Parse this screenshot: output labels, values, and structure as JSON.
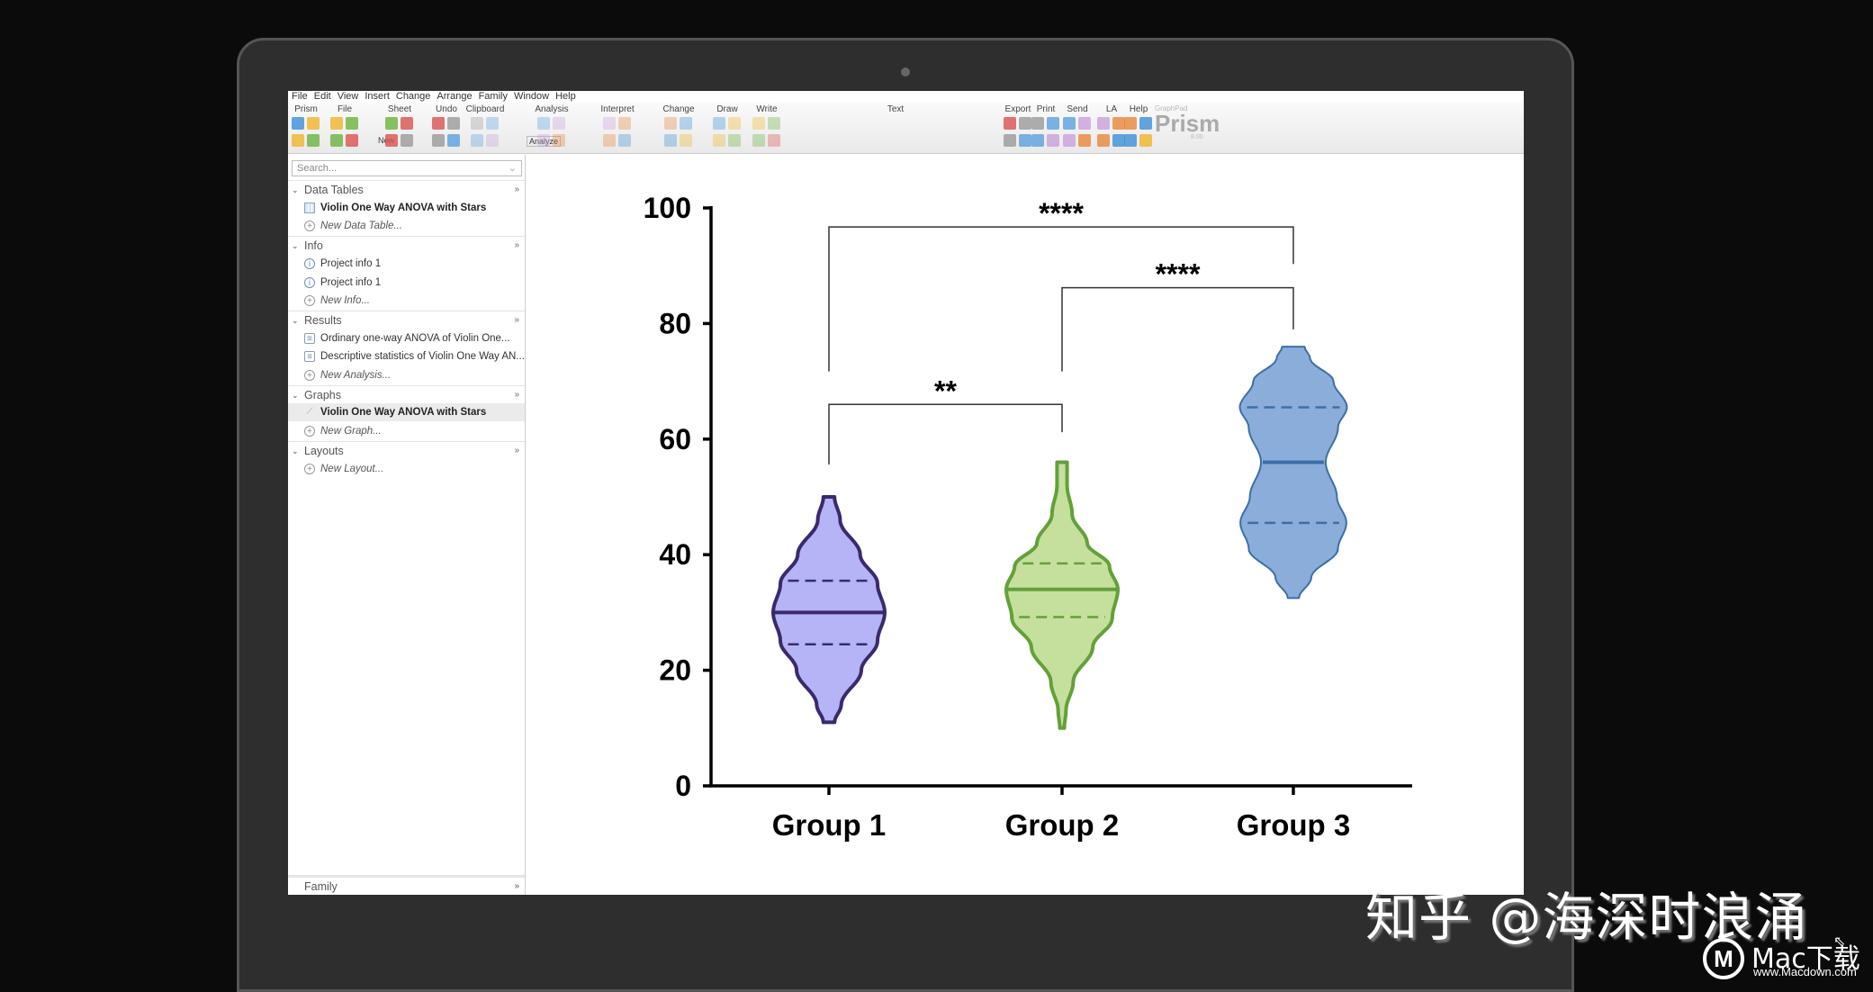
{
  "menu": [
    "File",
    "Edit",
    "View",
    "Insert",
    "Change",
    "Arrange",
    "Family",
    "Window",
    "Help"
  ],
  "ribbon": {
    "groups": [
      {
        "label": "Prism",
        "pos": 20
      },
      {
        "label": "File",
        "pos": 63
      },
      {
        "label": "Sheet",
        "pos": 124
      },
      {
        "label": "Undo",
        "pos": 176
      },
      {
        "label": "Clipboard",
        "pos": 219
      },
      {
        "label": "Analysis",
        "pos": 293
      },
      {
        "label": "Interpret",
        "pos": 366
      },
      {
        "label": "Change",
        "pos": 434
      },
      {
        "label": "Draw",
        "pos": 488
      },
      {
        "label": "Write",
        "pos": 532
      },
      {
        "label": "Text",
        "pos": 675
      },
      {
        "label": "Export",
        "pos": 811
      },
      {
        "label": "Print",
        "pos": 842
      },
      {
        "label": "Send",
        "pos": 877
      },
      {
        "label": "LA",
        "pos": 915
      },
      {
        "label": "Help",
        "pos": 945
      }
    ],
    "new_label": "New",
    "analyze_label": "Analyze",
    "brand_small": "GraphPad",
    "brand": "Prism",
    "version": "8.00"
  },
  "sidebar": {
    "search_placeholder": "Search...",
    "sections": [
      {
        "title": "Data Tables",
        "items": [
          {
            "label": "Violin One Way ANOVA with Stars",
            "icon": "data-table-icon",
            "style": "bold"
          },
          {
            "label": "New Data Table...",
            "icon": "plus-circle-icon",
            "style": "new"
          }
        ]
      },
      {
        "title": "Info",
        "items": [
          {
            "label": "Project info 1",
            "icon": "info-icon",
            "style": "normal"
          },
          {
            "label": "Project info 1",
            "icon": "info-icon",
            "style": "normal"
          },
          {
            "label": "New Info...",
            "icon": "plus-circle-icon",
            "style": "new"
          }
        ]
      },
      {
        "title": "Results",
        "items": [
          {
            "label": "Ordinary one-way ANOVA of Violin One...",
            "icon": "results-icon",
            "style": "normal"
          },
          {
            "label": "Descriptive statistics of Violin One Way AN...",
            "icon": "results-icon",
            "style": "normal"
          },
          {
            "label": "New Analysis...",
            "icon": "plus-circle-icon",
            "style": "new"
          }
        ]
      },
      {
        "title": "Graphs",
        "items": [
          {
            "label": "Violin One Way ANOVA with Stars",
            "icon": "graph-icon",
            "style": "bold selected"
          },
          {
            "label": "New Graph...",
            "icon": "plus-circle-icon",
            "style": "new"
          }
        ]
      },
      {
        "title": "Layouts",
        "items": [
          {
            "label": "New Layout...",
            "icon": "plus-circle-icon",
            "style": "new"
          }
        ]
      }
    ],
    "family_label": "Family"
  },
  "chart_data": {
    "type": "violin",
    "title": "",
    "xlabel": "",
    "ylabel": "",
    "ylim": [
      0,
      100
    ],
    "yticks": [
      0,
      20,
      40,
      60,
      80,
      100
    ],
    "grid": false,
    "categories": [
      "Group 1",
      "Group 2",
      "Group 3"
    ],
    "series": [
      {
        "min": 11,
        "q1": 24.5,
        "median": 30,
        "q3": 35.5,
        "max": 50,
        "fill": "#b5b4f7",
        "stroke": "#3a2a6c",
        "density": [
          [
            11,
            0.1
          ],
          [
            14,
            0.22
          ],
          [
            20,
            0.58
          ],
          [
            25,
            0.87
          ],
          [
            30,
            1.0
          ],
          [
            35,
            0.87
          ],
          [
            40,
            0.56
          ],
          [
            46,
            0.2
          ],
          [
            50,
            0.1
          ]
        ]
      },
      {
        "min": 10,
        "q1": 29.2,
        "median": 34,
        "q3": 38.5,
        "max": 56,
        "fill": "#c5e09c",
        "stroke": "#64a03a",
        "density": [
          [
            10,
            0.04
          ],
          [
            13,
            0.07
          ],
          [
            18,
            0.2
          ],
          [
            24,
            0.55
          ],
          [
            29,
            0.9
          ],
          [
            34,
            1.0
          ],
          [
            38,
            0.85
          ],
          [
            42,
            0.45
          ],
          [
            47,
            0.18
          ],
          [
            52,
            0.09
          ],
          [
            56,
            0.09
          ]
        ]
      },
      {
        "min": 32.5,
        "q1": 45.5,
        "median": 56,
        "q3": 65.5,
        "max": 76,
        "fill": "#8aaed9",
        "stroke": "#3c6ea8",
        "density": [
          [
            32.5,
            0.1
          ],
          [
            36,
            0.32
          ],
          [
            41,
            0.8
          ],
          [
            45.5,
            0.95
          ],
          [
            50,
            0.78
          ],
          [
            56,
            0.58
          ],
          [
            62,
            0.8
          ],
          [
            65.5,
            0.96
          ],
          [
            70,
            0.72
          ],
          [
            74,
            0.3
          ],
          [
            76,
            0.2
          ]
        ]
      }
    ],
    "significance": [
      {
        "from": 0,
        "to": 1,
        "label": "**",
        "y": 66,
        "leg_from": 55.6,
        "leg_to": 61.2
      },
      {
        "from": 1,
        "to": 2,
        "label": "****",
        "y": 86.2,
        "leg_from": 71.7,
        "leg_to": 79
      },
      {
        "from": 0,
        "to": 2,
        "label": "****",
        "y": 96.7,
        "leg_from": 71.7,
        "leg_to": 90.3
      }
    ]
  },
  "watermark": {
    "text": "知乎 @海深时浪涌",
    "logo_text": "Mac下载",
    "logo_url_text": "www.Macdown.com"
  }
}
